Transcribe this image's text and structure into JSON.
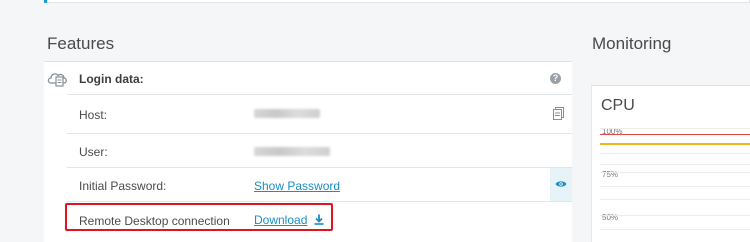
{
  "features": {
    "title": "Features",
    "login": {
      "heading": "Login data:",
      "help_icon": "?",
      "host_label": "Host:",
      "user_label": "User:",
      "password_label": "Initial Password:",
      "show_password": "Show Password",
      "rdp_label": "Remote Desktop connection",
      "download": "Download"
    }
  },
  "monitoring": {
    "title": "Monitoring",
    "cpu_title": "CPU"
  },
  "chart_data": {
    "type": "line",
    "title": "CPU",
    "ticks": [
      "100%",
      "75%",
      "50%"
    ]
  },
  "colors": {
    "accent": "#1b9bd1",
    "link": "#1b8ec2",
    "highlight": "#e0141e",
    "cpu_line_red": "#e4464a",
    "cpu_line_orange": "#f2b31d"
  }
}
